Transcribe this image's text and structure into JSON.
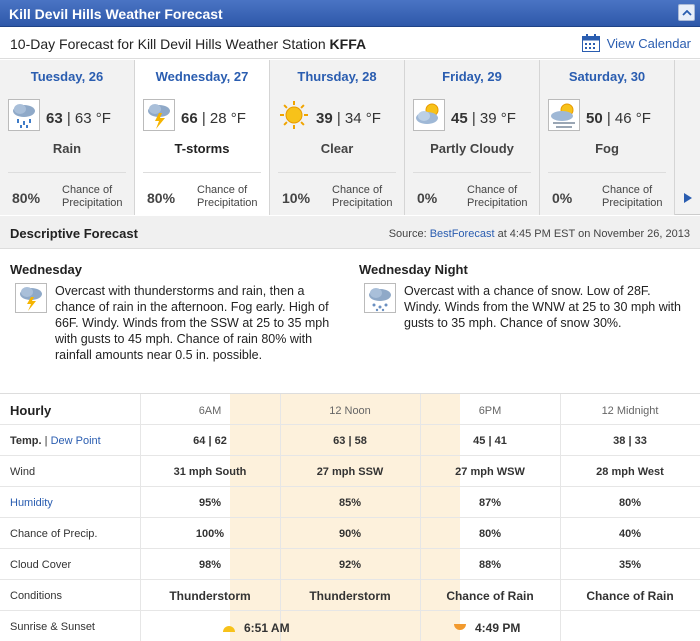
{
  "window": {
    "title": "Kill Devil Hills Weather Forecast"
  },
  "subheader": {
    "prefix": "10-Day Forecast for Kill Devil Hills Weather Station",
    "station": "KFFA",
    "calendar_label": "View Calendar"
  },
  "days": [
    {
      "name": "Tuesday, 26",
      "high": "63",
      "low": "63 °F",
      "condition": "Rain",
      "precip": "80%",
      "icon": "rain-icon"
    },
    {
      "name": "Wednesday, 27",
      "high": "66",
      "low": "28 °F",
      "condition": "T-storms",
      "precip": "80%",
      "icon": "thunderstorm-icon",
      "selected": true
    },
    {
      "name": "Thursday, 28",
      "high": "39",
      "low": "34 °F",
      "condition": "Clear",
      "precip": "10%",
      "icon": "sun-icon"
    },
    {
      "name": "Friday, 29",
      "high": "45",
      "low": "39 °F",
      "condition": "Partly Cloudy",
      "precip": "0%",
      "icon": "partly-cloudy-icon"
    },
    {
      "name": "Saturday, 30",
      "high": "50",
      "low": "46 °F",
      "condition": "Fog",
      "precip": "0%",
      "icon": "fog-icon"
    }
  ],
  "precip_label_1": "Chance of",
  "precip_label_2": "Precipitation",
  "descriptive": {
    "title": "Descriptive Forecast",
    "source_prefix": "Source:",
    "source_link": "BestForecast",
    "source_suffix": "at 4:45 PM EST on November 26, 2013",
    "periods": [
      {
        "title": "Wednesday",
        "icon": "thunderstorm-icon",
        "text": "Overcast with thunderstorms and rain, then a chance of rain in the afternoon. Fog early. High of 66F. Windy. Winds from the SSW at 25 to 35 mph with gusts to 45 mph. Chance of rain 80% with rainfall amounts near 0.5 in. possible."
      },
      {
        "title": "Wednesday Night",
        "icon": "snow-icon",
        "text": "Overcast with a chance of snow. Low of 28F. Windy. Winds from the WNW at 25 to 30 mph with gusts to 35 mph. Chance of snow 30%."
      }
    ]
  },
  "hourly": {
    "title": "Hourly",
    "times": [
      "6AM",
      "12 Noon",
      "6PM",
      "12 Midnight"
    ],
    "rows": [
      {
        "label": "Temp.",
        "label2": "Dew Point",
        "values": [
          "64 | 62",
          "63 | 58",
          "45 | 41",
          "38 | 33"
        ]
      },
      {
        "label": "Wind",
        "values": [
          "31 mph South",
          "27 mph SSW",
          "27 mph WSW",
          "28 mph West"
        ]
      },
      {
        "label": "Humidity",
        "values": [
          "95%",
          "85%",
          "87%",
          "80%"
        ]
      },
      {
        "label": "Chance of Precip.",
        "values": [
          "100%",
          "90%",
          "80%",
          "40%"
        ]
      },
      {
        "label": "Cloud Cover",
        "values": [
          "98%",
          "92%",
          "88%",
          "35%"
        ]
      },
      {
        "label": "Conditions",
        "values": [
          "Thunderstorm",
          "Thunderstorm",
          "Chance of Rain",
          "Chance of Rain"
        ]
      }
    ],
    "sun_label": "Sunrise & Sunset",
    "sunrise": "6:51 AM",
    "sunset": "4:49 PM"
  },
  "colors": {
    "accent": "#2a5db0",
    "titlebar": "#2e58a9",
    "daylight": "#fdf1dc"
  }
}
